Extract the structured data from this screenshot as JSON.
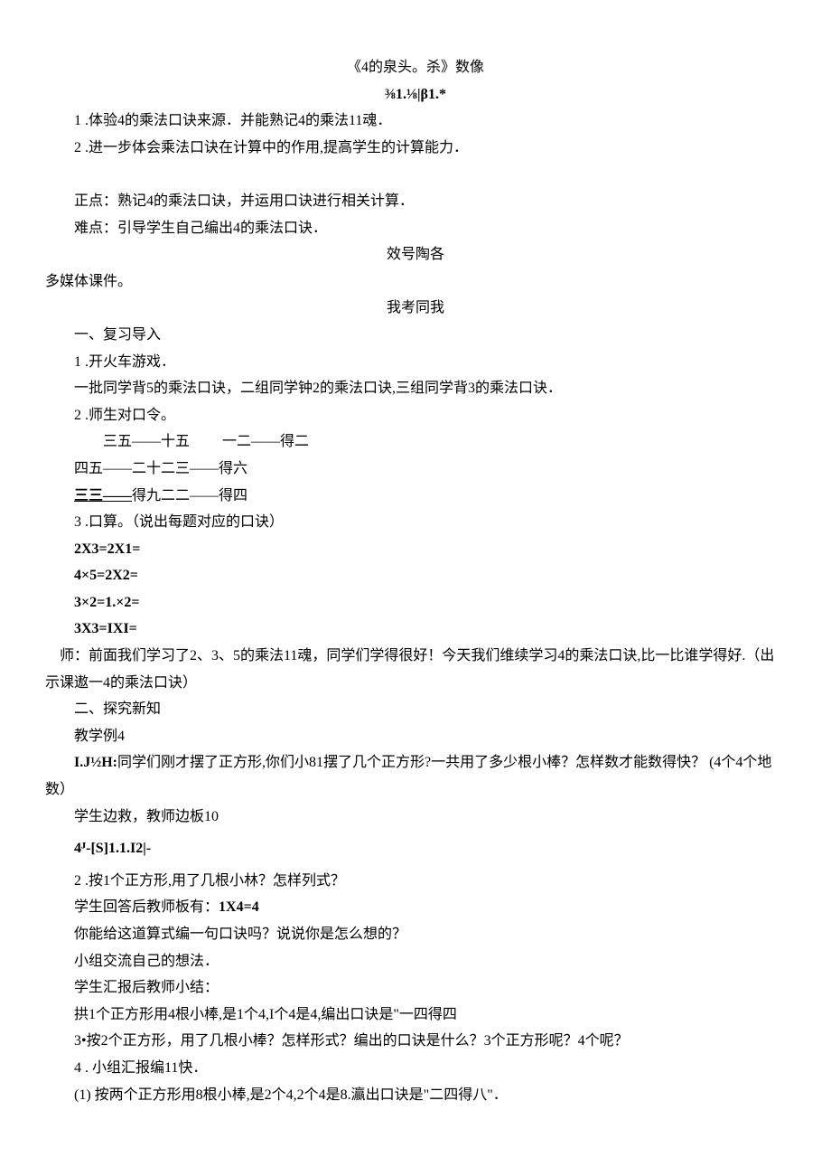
{
  "title": "《4的泉头。杀》数像",
  "subtitle": "⅜1.⅛|β1.*",
  "goals": {
    "g1": "1 .体验4的乘法口诀来源．并能熟记4的乘法11魂．",
    "g2": "2  .进一步体会乘法口诀在计算中的作用,提高学生的计算能力．"
  },
  "points": {
    "p1": "正点：熟记4的乘法口诀，并运用口诀进行相关计算．",
    "p2": "难点：引导学生自己编出4的乘法口诀．"
  },
  "section_heading_1": "效号陶各",
  "media": "多媒体课件。",
  "section_heading_2": "我考同我",
  "part1": {
    "h": "一、复习导入",
    "l1": "1 .开火车游戏．",
    "l2": "一批同学背5的乘法口诀，二组同学钟2的乘法口诀,三组同学背3的乘法口诀．",
    "l3": "2  .师生对口令。",
    "l4a": "三五——十五",
    "l4b": "一二——得二",
    "l5": "四五——二十二三——得六",
    "l6u": "三三——",
    "l6r": "得九二二——得四",
    "l7": "3  .口算。（说出每题对应的口诀）",
    "eq1": "2X3=2X1=",
    "eq2": "4×5=2X2=",
    "eq3": "3×2=1.×2=",
    "eq4": "3X3=IXI=",
    "l8": " 师：前面我们学习了2、3、5的乘法11魂，同学们学得很好！今天我们维续学习4的乘法口诀,比一比谁学得好.（出示课遨一4的乘法口诀）"
  },
  "part2": {
    "h": "二、探究新知",
    "l1": "教学例4",
    "l2a": "I.J½H:",
    "l2b": "同学们刚才摆了正方形,你们小81摆了几个正方形?一共用了多少根小棒？怎样数才能数得快？  (4个4个地数）",
    "l3": "学生边救，教师边板10",
    "l4": "4ᴶ-[S]1.1.I2|-",
    "l5": "2  .按1个正方形,用了几根小林？怎样列式？",
    "l6a": "学生回答后教师板有：",
    "l6b": "1X4=4",
    "l7": "你能给这道算式编一句口诀吗？说说你是怎么想的？",
    "l8": "小组交流自己的想法．",
    "l9": "学生汇报后教师小结：",
    "l10": "拱1个正方形用4根小棒,是1个4,I个4是4,编出口诀是\"一四得四",
    "l11": "3•按2个正方形，用了几根小棒？怎样形式？编出的口诀是什么？3个正方形呢？4个呢？",
    "l12": "4  . 小组汇报编11快．",
    "l13": " (1)  按两个正方形用8根小棒,是2个4,2个4是8.瀛出口诀是\"二四得八\"．"
  }
}
